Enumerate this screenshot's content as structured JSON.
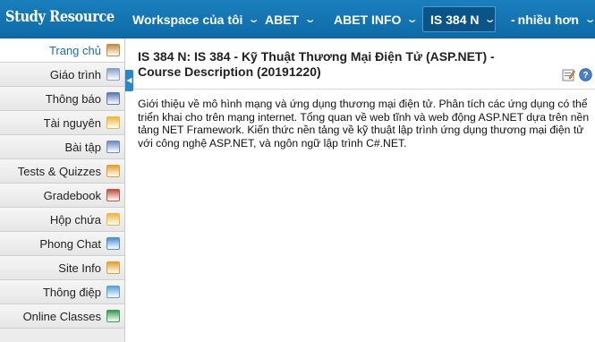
{
  "header": {
    "brand": "Study Resource",
    "nav": [
      {
        "label": "Workspace của tôi"
      },
      {
        "label": "ABET"
      },
      {
        "label": "ABET INFO"
      },
      {
        "label": "IS 384 N"
      },
      {
        "label": "nhiều hơn"
      }
    ],
    "more_prefix": "-"
  },
  "sidebar": {
    "items": [
      {
        "label": "Trang chủ",
        "icon": "home-icon",
        "color": "#c8893a"
      },
      {
        "label": "Giáo trình",
        "icon": "syllabus-icon",
        "color": "#8aa0c8"
      },
      {
        "label": "Thông báo",
        "icon": "announcement-icon",
        "color": "#5a78b8"
      },
      {
        "label": "Tài nguyên",
        "icon": "folder-icon",
        "color": "#e8b840"
      },
      {
        "label": "Bài tập",
        "icon": "assignment-icon",
        "color": "#6a8ac0"
      },
      {
        "label": "Tests & Quizzes",
        "icon": "pencil-icon",
        "color": "#e0a030"
      },
      {
        "label": "Gradebook",
        "icon": "gradebook-icon",
        "color": "#c05040"
      },
      {
        "label": "Hộp chứa",
        "icon": "dropbox-icon",
        "color": "#e8b840"
      },
      {
        "label": "Phong Chat",
        "icon": "chat-icon",
        "color": "#4a90d0"
      },
      {
        "label": "Site Info",
        "icon": "siteinfo-icon",
        "color": "#e0a030"
      },
      {
        "label": "Thông điệp",
        "icon": "message-icon",
        "color": "#5aa0d8"
      },
      {
        "label": "Online Classes",
        "icon": "online-classes-icon",
        "color": "#3a9a50"
      }
    ]
  },
  "main": {
    "title": "IS 384 N: IS 384 - Kỹ Thuật Thương Mại Điện Tử (ASP.NET) - Course Description (20191220)",
    "description": "Giới thiệu về mô hình mạng và ứng dụng thương mại điện tử. Phân tích các ứng dụng có thể triển khai cho trên mạng internet. Tổng quan về web tĩnh và web động ASP.NET dựa trên nền tảng NET Framework. Kiến thức nền tảng về kỹ thuật lập trình ứng dụng thương mại điện tử với công nghệ ASP.NET, và ngôn ngữ lập trình C#.NET."
  },
  "colors": {
    "topbar": "#1474b2",
    "accent": "#1a6fb0"
  }
}
